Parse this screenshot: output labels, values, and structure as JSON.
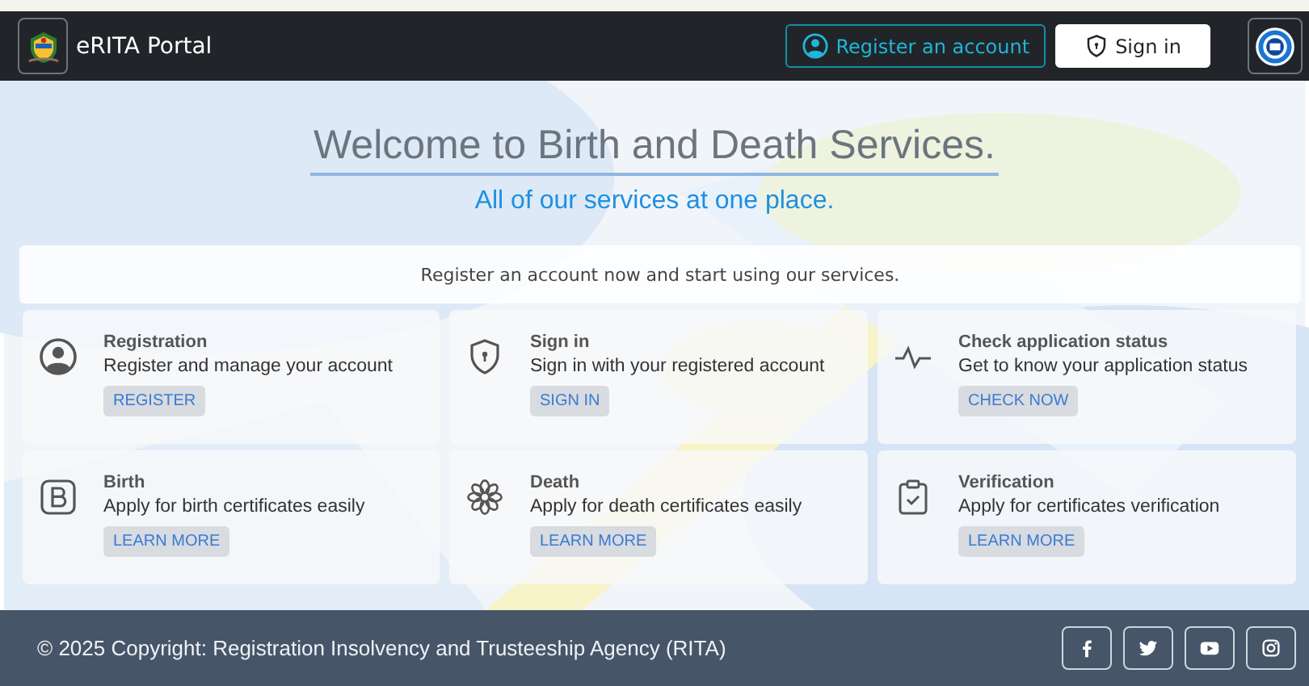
{
  "navbar": {
    "brand": "eRITA Portal",
    "buttons": [
      {
        "label": "Register an account",
        "kind": "outline"
      },
      {
        "label": "Sign in",
        "kind": "solid"
      }
    ]
  },
  "hero": {
    "title": "Welcome to Birth and Death Services.",
    "subtitle": "All of our services at one place.",
    "notice": "Register an account now and start using our services."
  },
  "services": [
    {
      "kind": "user",
      "title": "Registration",
      "description": "Register and manage your account",
      "action": "REGISTER"
    },
    {
      "kind": "shield",
      "title": "Sign in",
      "description": "Sign in with your registered account",
      "action": "SIGN IN"
    },
    {
      "kind": "pulse",
      "title": "Check application status",
      "description": "Get to know your application status",
      "action": "CHECK NOW"
    },
    {
      "kind": "letter",
      "title": "Birth",
      "description": "Apply for birth certificates easily",
      "action": "LEARN MORE"
    },
    {
      "kind": "flower",
      "title": "Death",
      "description": "Apply for death certificates easily",
      "action": "LEARN MORE"
    },
    {
      "kind": "clipboard",
      "title": "Verification",
      "description": "Apply for certificates verification",
      "action": "LEARN MORE"
    }
  ],
  "footer": {
    "copyright": "© 2025 Copyright: Registration Insolvency and Trusteeship Agency (RITA)",
    "social": [
      {
        "kind": "facebook"
      },
      {
        "kind": "twitter"
      },
      {
        "kind": "youtube"
      },
      {
        "kind": "instagram"
      }
    ]
  }
}
